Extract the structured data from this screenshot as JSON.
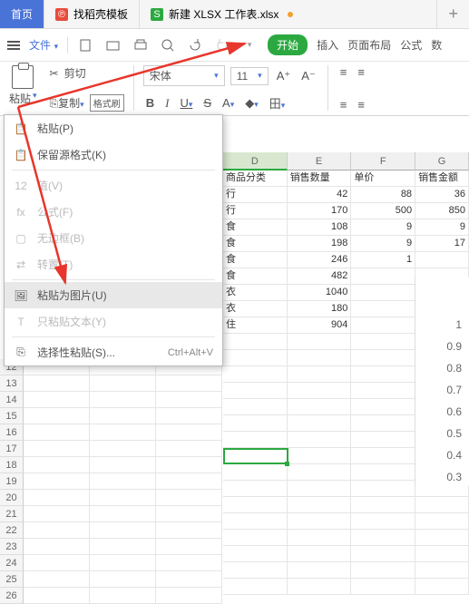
{
  "tabs": {
    "home": "首页",
    "template": "找稻壳模板",
    "doc": "新建 XLSX 工作表.xlsx"
  },
  "file": {
    "label": "文件"
  },
  "menu": {
    "start": "开始",
    "insert": "插入",
    "layout": "页面布局",
    "formula": "公式",
    "d": "数"
  },
  "clip": {
    "paste": "粘贴",
    "cut": "剪切",
    "copy": "复制",
    "brush": "格式刷"
  },
  "font": {
    "name": "宋体",
    "size": "11"
  },
  "popup": {
    "paste": "粘贴(P)",
    "keep": "保留源格式(K)",
    "value": "值(V)",
    "formula": "公式(F)",
    "noborder": "无边框(B)",
    "transpose": "转置(T)",
    "asimg": "粘贴为图片(U)",
    "textonly": "只粘贴文本(Y)",
    "special": "选择性粘贴(S)...",
    "shortcut": "Ctrl+Alt+V"
  },
  "cols": {
    "D": "D",
    "E": "E",
    "F": "F",
    "G": "G"
  },
  "hdr": {
    "cat": "商品分类",
    "qty": "销售数量",
    "price": "单价",
    "amt": "销售金额"
  },
  "rows": [
    {
      "c": "行",
      "q": 42,
      "p": 88,
      "a": "36"
    },
    {
      "c": "行",
      "q": 170,
      "p": 500,
      "a": "850"
    },
    {
      "c": "食",
      "q": 108,
      "p": 9,
      "a": "9"
    },
    {
      "c": "食",
      "q": 198,
      "p": 9,
      "a": "17"
    },
    {
      "c": "食",
      "q": 246,
      "p": 1,
      "a": ""
    },
    {
      "c": "食",
      "q": 482,
      "p": "",
      "a": ""
    },
    {
      "c": "衣",
      "q": 1040,
      "p": "",
      "a": ""
    },
    {
      "c": "衣",
      "q": 180,
      "p": "",
      "a": ""
    },
    {
      "c": "住",
      "q": 904,
      "p": "",
      "a": ""
    }
  ],
  "leftrows": [
    "12",
    "13",
    "14",
    "15",
    "16",
    "17",
    "18",
    "19",
    "20",
    "21",
    "22",
    "23",
    "24",
    "25",
    "26"
  ],
  "chart_data": {
    "type": "line",
    "ylim": [
      0,
      1
    ],
    "yticks": [
      1,
      0.9,
      0.8,
      0.7,
      0.6,
      0.5,
      0.4,
      0.3
    ]
  }
}
